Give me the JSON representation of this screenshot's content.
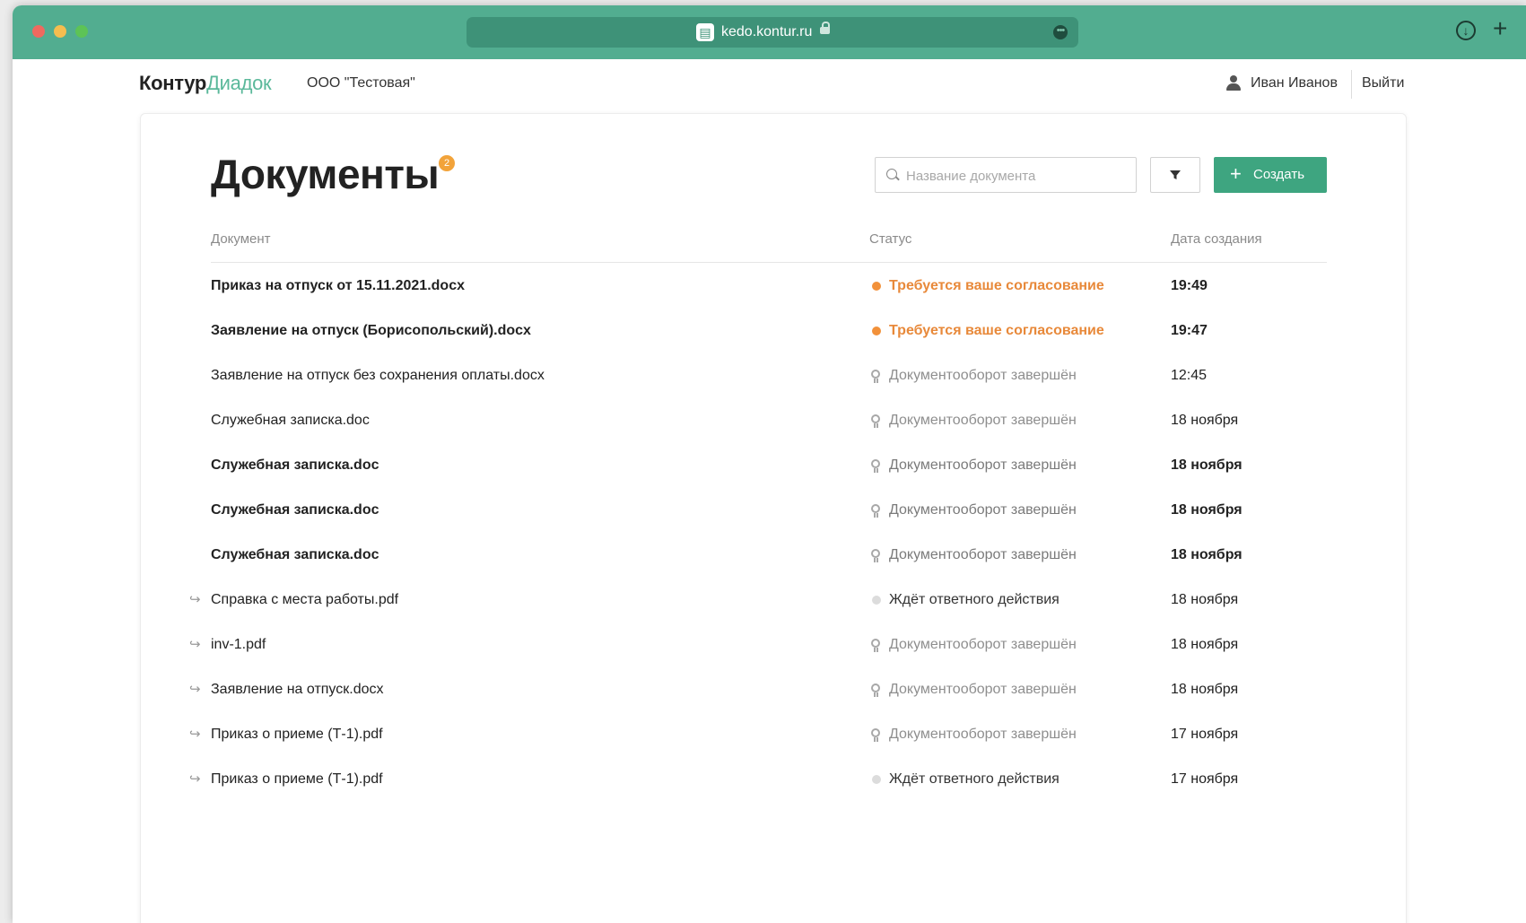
{
  "browser": {
    "url": "kedo.kontur.ru"
  },
  "header": {
    "brand_part1": "Контур",
    "brand_part2": "Диадок",
    "org": "ООО \"Тестовая\"",
    "user_name": "Иван Иванов",
    "logout": "Выйти"
  },
  "page": {
    "title": "Документы",
    "badge_count": "2",
    "search_placeholder": "Название документа",
    "create_label": "Создать",
    "columns": {
      "document": "Документ",
      "status": "Статус",
      "date": "Дата создания"
    }
  },
  "documents": [
    {
      "name": "Приказ на отпуск от 15.11.2021.docx",
      "status": "Требуется ваше согласование",
      "status_kind": "attention",
      "date": "19:49",
      "bold": true,
      "forwarded": false
    },
    {
      "name": "Заявление на отпуск (Борисопольский).docx",
      "status": "Требуется ваше согласование",
      "status_kind": "attention",
      "date": "19:47",
      "bold": true,
      "forwarded": false
    },
    {
      "name": "Заявление на отпуск без сохранения оплаты.docx",
      "status": "Документооборот завершён",
      "status_kind": "done",
      "date": "12:45",
      "bold": false,
      "forwarded": false
    },
    {
      "name": "Служебная записка.doc",
      "status": "Документооборот завершён",
      "status_kind": "done",
      "date": "18 ноября",
      "bold": false,
      "forwarded": false
    },
    {
      "name": "Служебная записка.doc",
      "status": "Документооборот завершён",
      "status_kind": "done",
      "date": "18 ноября",
      "bold": true,
      "forwarded": false
    },
    {
      "name": "Служебная записка.doc",
      "status": "Документооборот завершён",
      "status_kind": "done",
      "date": "18 ноября",
      "bold": true,
      "forwarded": false
    },
    {
      "name": "Служебная записка.doc",
      "status": "Документооборот завершён",
      "status_kind": "done",
      "date": "18 ноября",
      "bold": true,
      "forwarded": false
    },
    {
      "name": "Справка с места работы.pdf",
      "status": "Ждёт ответного действия",
      "status_kind": "waiting",
      "date": "18 ноября",
      "bold": false,
      "forwarded": true
    },
    {
      "name": "inv-1.pdf",
      "status": "Документооборот завершён",
      "status_kind": "done",
      "date": "18 ноября",
      "bold": false,
      "forwarded": true
    },
    {
      "name": "Заявление на отпуск.docx",
      "status": "Документооборот завершён",
      "status_kind": "done",
      "date": "18 ноября",
      "bold": false,
      "forwarded": true
    },
    {
      "name": "Приказ о приеме (Т-1).pdf",
      "status": "Документооборот завершён",
      "status_kind": "done",
      "date": "17 ноября",
      "bold": false,
      "forwarded": true
    },
    {
      "name": "Приказ о приеме (Т-1).pdf",
      "status": "Ждёт ответного действия",
      "status_kind": "waiting",
      "date": "17 ноября",
      "bold": false,
      "forwarded": true
    }
  ],
  "icons": {
    "forward": "forward-arrow-icon",
    "attention": "orange-dot-icon",
    "done": "seal-icon",
    "waiting": "grey-dot-icon"
  },
  "colors": {
    "brand": "#52ad90",
    "primary_button": "#3ea580",
    "attention": "#e8893a"
  }
}
